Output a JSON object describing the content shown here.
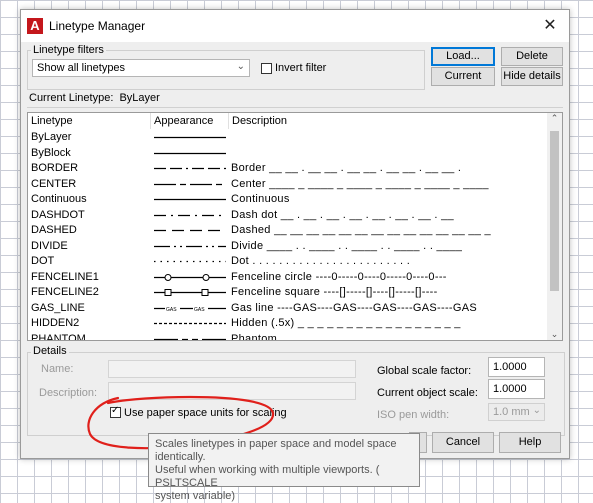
{
  "dialog": {
    "title": "Linetype Manager",
    "close_glyph": "✕",
    "app_logo": "A"
  },
  "filters": {
    "group_label": "Linetype filters",
    "selected": "Show all linetypes",
    "invert_label": "Invert filter",
    "invert_checked": false
  },
  "buttons": {
    "load": "Load...",
    "delete": "Delete",
    "current": "Current",
    "hide_details": "Hide details",
    "cancel": "Cancel",
    "help": "Help"
  },
  "current_linetype": {
    "label": "Current Linetype:",
    "value": "ByLayer"
  },
  "table": {
    "headers": [
      "Linetype",
      "Appearance",
      "Description"
    ],
    "rows": [
      {
        "name": "ByLayer",
        "description": "",
        "pattern": "solid"
      },
      {
        "name": "ByBlock",
        "description": "",
        "pattern": "solid"
      },
      {
        "name": "BORDER",
        "description": "Border __ __ . __ __ . __ __ . __ __ . __ __ .",
        "pattern": "border"
      },
      {
        "name": "CENTER",
        "description": "Center ____ _ ____ _ ____ _ ____ _ ____ _ ____",
        "pattern": "center"
      },
      {
        "name": "Continuous",
        "description": "Continuous",
        "pattern": "solid"
      },
      {
        "name": "DASHDOT",
        "description": "Dash dot __ . __ . __ . __ . __ . __ . __ . __",
        "pattern": "dashdot"
      },
      {
        "name": "DASHED",
        "description": "Dashed __ __ __ __ __ __ __ __ __ __ __ __ __ _",
        "pattern": "dashed"
      },
      {
        "name": "DIVIDE",
        "description": "Divide ____ . . ____ . . ____ . . ____ . . ____",
        "pattern": "divide"
      },
      {
        "name": "DOT",
        "description": "Dot . . . . . . . . . . . . . . . . . . . . . . . .",
        "pattern": "dot"
      },
      {
        "name": "FENCELINE1",
        "description": "Fenceline circle ----0-----0----0-----0----0---",
        "pattern": "fence1"
      },
      {
        "name": "FENCELINE2",
        "description": "Fenceline square ----[]-----[]----[]-----[]----",
        "pattern": "fence2"
      },
      {
        "name": "GAS_LINE",
        "description": "Gas line ----GAS----GAS----GAS----GAS----GAS",
        "pattern": "gas"
      },
      {
        "name": "HIDDEN2",
        "description": "Hidden (.5x) _ _ _ _ _ _ _ _ _ _ _ _ _ _ _ _ _",
        "pattern": "hidden2"
      },
      {
        "name": "PHANTOM",
        "description": "Phantom ______ __ __ ______ __ __ ______",
        "pattern": "phantom"
      }
    ],
    "gas_text": "GAS"
  },
  "details": {
    "group_label": "Details",
    "name_label": "Name:",
    "description_label": "Description:",
    "name_value": "",
    "description_value": "",
    "paper_space_label": "Use paper space units for scaling",
    "paper_space_checked": true,
    "global_scale_label": "Global scale factor:",
    "global_scale_value": "1.0000",
    "current_scale_label": "Current object scale:",
    "current_scale_value": "1.0000",
    "iso_pen_label": "ISO pen width:",
    "iso_pen_value": "1.0 mm"
  },
  "tooltip": {
    "line1": "Scales linetypes in paper space and model space identically.",
    "line2": "Useful when working with multiple viewports. ( PSLTSCALE",
    "line3": "system variable)"
  },
  "colors": {
    "accent": "#0078d7",
    "logo": "#c4171c",
    "annotation": "#e0201b"
  }
}
